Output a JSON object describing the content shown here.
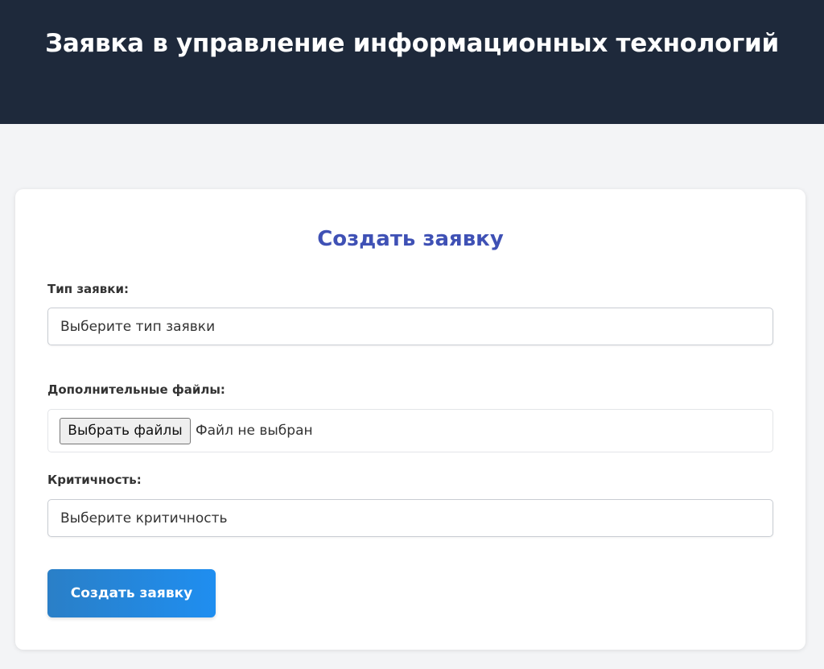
{
  "header": {
    "title": "Заявка в управление информационных технологий",
    "background": "#1e293b"
  },
  "form": {
    "title": "Создать заявку",
    "request_type": {
      "label": "Тип заявки:",
      "value": "Выберите тип заявки"
    },
    "files": {
      "label": "Дополнительные файлы:",
      "button_label": "Выбрать файлы",
      "status": "Файл не выбран"
    },
    "priority": {
      "label": "Критичность:",
      "value": "Выберите критичность"
    },
    "submit_label": "Создать заявку"
  },
  "colors": {
    "title_accent": "#3f51b5",
    "button_start": "#2a7fc7",
    "button_end": "#1f8ef0",
    "page_background": "#f3f4f6"
  }
}
